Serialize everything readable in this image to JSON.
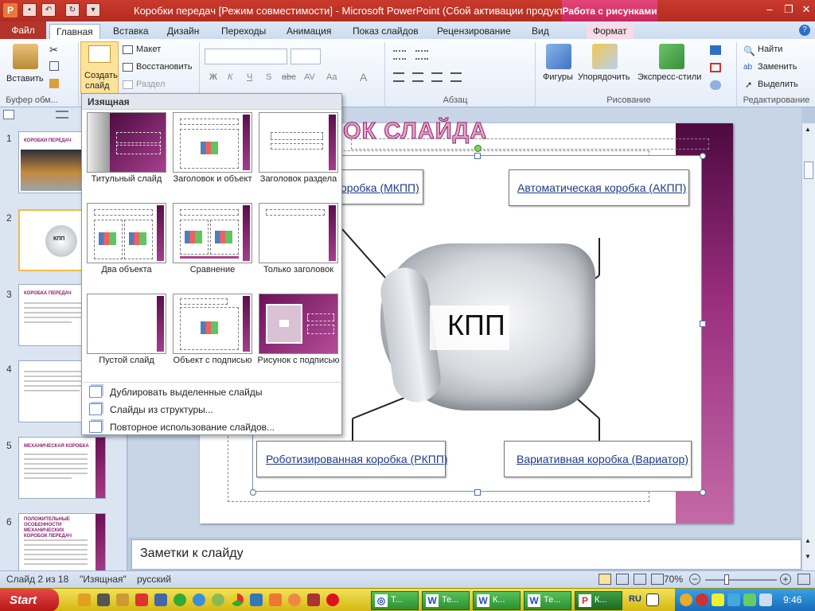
{
  "app": {
    "title": "Коробки передач [Режим совместимости]  -  Microsoft PowerPoint (Сбой активации продукта)",
    "context_tab": "Работа с рисунками"
  },
  "tabs": {
    "file": "Файл",
    "home": "Главная",
    "insert": "Вставка",
    "design": "Дизайн",
    "transitions": "Переходы",
    "animation": "Анимация",
    "slideshow": "Показ слайдов",
    "review": "Рецензирование",
    "view": "Вид",
    "format": "Формат"
  },
  "ribbon": {
    "clipboard": {
      "paste": "Вставить",
      "label": "Буфер обм..."
    },
    "slides": {
      "new_slide_1": "Создать",
      "new_slide_2": "слайд",
      "layout": "Макет",
      "reset": "Восстановить",
      "section": "Раздел"
    },
    "font": {
      "buttons": [
        "Ж",
        "К",
        "Ч",
        "S",
        "abc",
        "AV",
        "Aa",
        "A"
      ]
    },
    "paragraph": {
      "label": "Абзац"
    },
    "drawing": {
      "shapes": "Фигуры",
      "arrange": "Упорядочить",
      "quick_styles": "Экспресс-стили",
      "label": "Рисование"
    },
    "editing": {
      "find": "Найти",
      "replace": "Заменить",
      "select": "Выделить",
      "label": "Редактирование"
    }
  },
  "layout_menu": {
    "header": "Изящная",
    "layouts": [
      "Титульный слайд",
      "Заголовок и объект",
      "Заголовок раздела",
      "Два объекта",
      "Сравнение",
      "Только заголовок",
      "Пустой слайд",
      "Объект с подписью",
      "Рисунок с подписью"
    ],
    "commands": [
      "Дублировать выделенные слайды",
      "Слайды из структуры...",
      "Повторное использование слайдов..."
    ]
  },
  "thumbnails": [
    {
      "num": "1",
      "title": "КОРОБКИ ПЕРЕДАЧ"
    },
    {
      "num": "2",
      "title": "КПП"
    },
    {
      "num": "3",
      "title": "КОРОБКА ПЕРЕДАЧ"
    },
    {
      "num": "4",
      "title": ""
    },
    {
      "num": "5",
      "title": "МЕХАНИЧЕСКАЯ КОРОБКА"
    },
    {
      "num": "6",
      "title": "ПОЛОЖИТЕЛЬНЫЕ ОСОБЕННОСТИ МЕХАНИЧЕСКИХ КОРОБОК ПЕРЕДАЧ"
    }
  ],
  "slide": {
    "title": "ОК СЛАЙДА",
    "center_label": "КПП",
    "boxes": {
      "manual": "оробка (МКПП)",
      "auto": "Автоматическая коробка (АКПП)",
      "robot": "Роботизированная коробка (РКПП)",
      "cvt": "Вариативная коробка (Вариатор)"
    }
  },
  "notes_placeholder": "Заметки к слайду",
  "status": {
    "slide": "Слайд 2 из 18",
    "theme": "\"Изящная\"",
    "language": "русский",
    "zoom": "70%"
  },
  "taskbar": {
    "start": "Start",
    "tasks": [
      "Т...",
      "Те...",
      "К...",
      "Те...",
      "К..."
    ],
    "tray": {
      "lang": "RU",
      "time": "9:46"
    }
  },
  "colors": {
    "accent": "#b33026",
    "theme_purple": "#8a1f6f",
    "context": "#d63a6b"
  }
}
